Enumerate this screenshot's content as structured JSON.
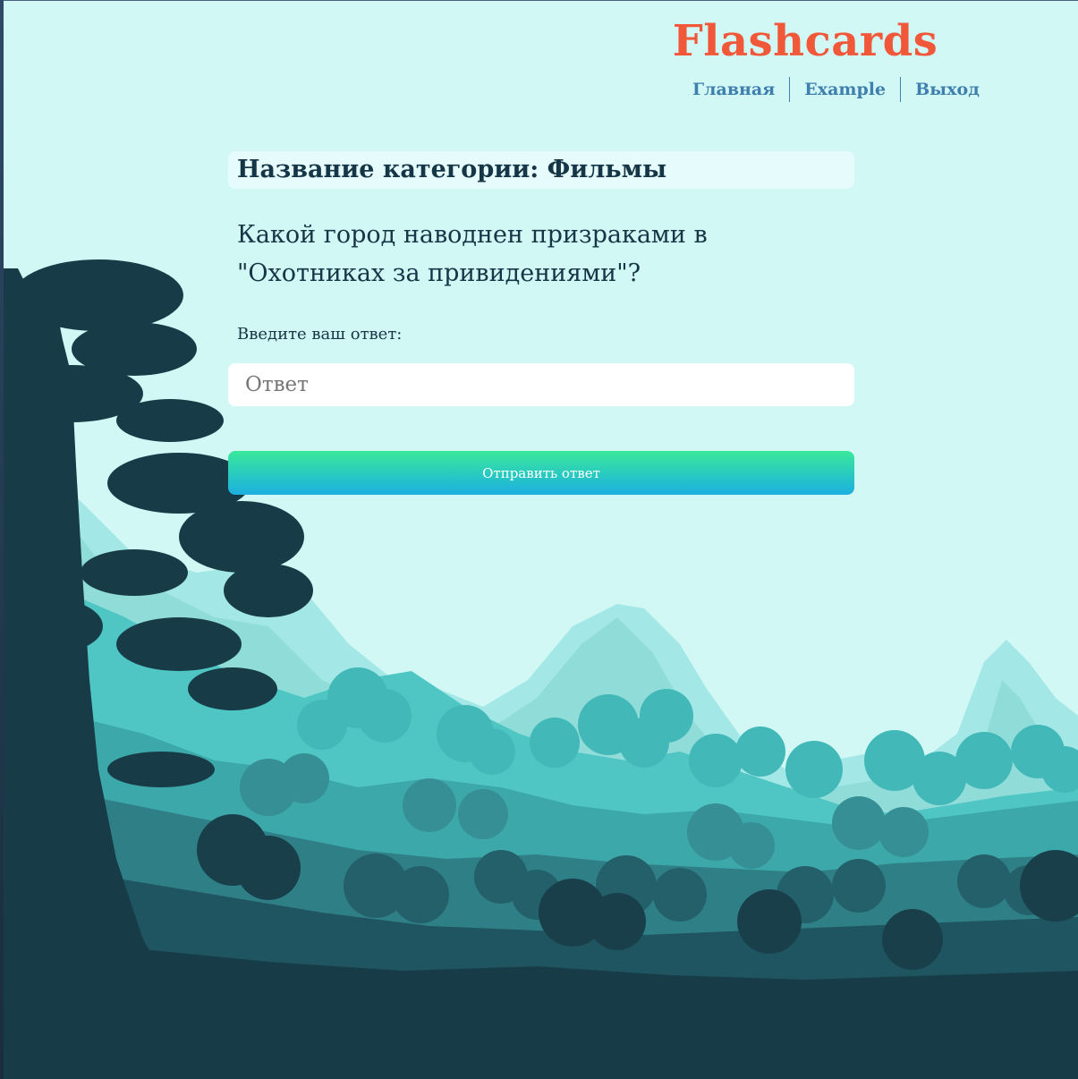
{
  "header": {
    "brand": "Flashcards",
    "nav": [
      {
        "label": "Главная"
      },
      {
        "label": "Example"
      },
      {
        "label": "Выход"
      }
    ]
  },
  "card": {
    "category": "Название категории: Фильмы",
    "question": "Какой город наводнен призраками в \"Охотниках за привидениями\"?",
    "answer_label": "Введите ваш ответ:",
    "answer_placeholder": "Ответ",
    "answer_value": "",
    "submit_label": "Отправить ответ"
  },
  "colors": {
    "background": "#d1f8f5",
    "brand": "#f1583a",
    "nav_link": "#3f7fae",
    "text": "#153646",
    "button_top": "#39e99b",
    "button_bottom": "#1cafe0",
    "forest_dark": "#173c47"
  },
  "icons": [
    "forest-landscape-illustration"
  ]
}
